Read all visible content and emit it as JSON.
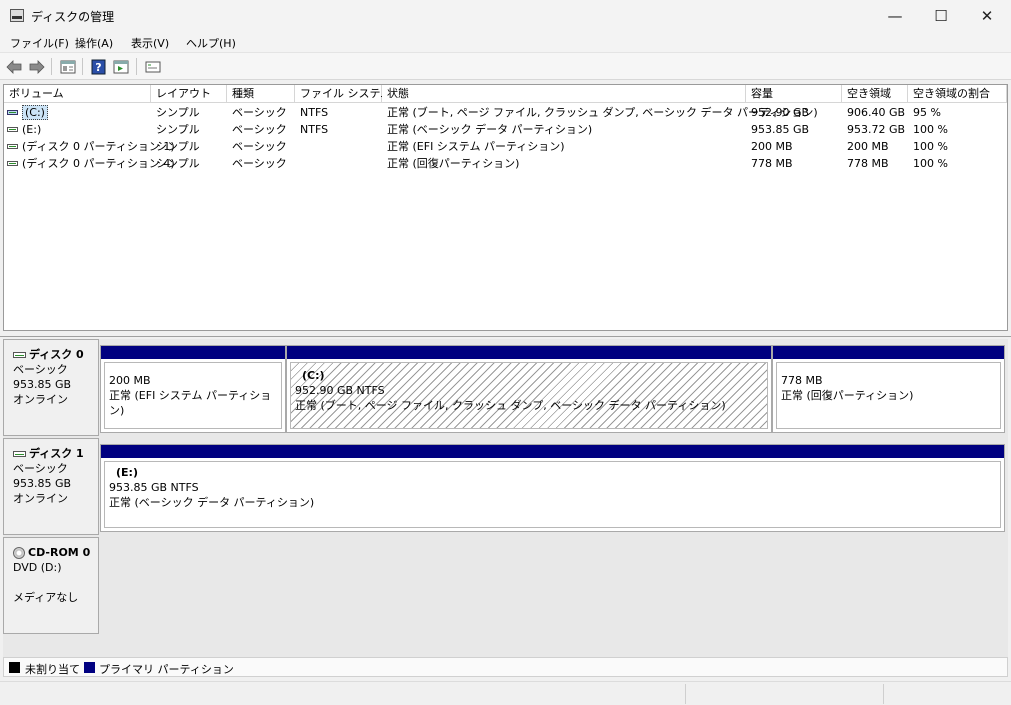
{
  "window": {
    "title": "ディスクの管理",
    "minimize": "—",
    "maximize": "☐",
    "close": "✕"
  },
  "menu": [
    "ファイル(F)",
    "操作(A)",
    "表示(V)",
    "ヘルプ(H)"
  ],
  "toolbar": {
    "icons": [
      "back-arrow-icon",
      "forward-arrow-icon",
      "properties-icon",
      "help-icon",
      "show-hide-pane-icon",
      "console-icon"
    ]
  },
  "volume_table": {
    "columns": [
      "ボリューム",
      "レイアウト",
      "種類",
      "ファイル システム",
      "状態",
      "容量",
      "空き領域",
      "空き領域の割合"
    ],
    "rows": [
      [
        "(C:)",
        "シンプル",
        "ベーシック",
        "NTFS",
        "正常 (ブート, ページ ファイル, クラッシュ ダンプ, ベーシック データ パーティション)",
        "952.90 GB",
        "906.40 GB",
        "95 %"
      ],
      [
        "(E:)",
        "シンプル",
        "ベーシック",
        "NTFS",
        "正常 (ベーシック データ パーティション)",
        "953.85 GB",
        "953.72 GB",
        "100 %"
      ],
      [
        "(ディスク 0 パーティション 1)",
        "シンプル",
        "ベーシック",
        "",
        "正常 (EFI システム パーティション)",
        "200 MB",
        "200 MB",
        "100 %"
      ],
      [
        "(ディスク 0 パーティション 4)",
        "シンプル",
        "ベーシック",
        "",
        "正常 (回復パーティション)",
        "778 MB",
        "778 MB",
        "100 %"
      ]
    ]
  },
  "disks": [
    {
      "name": "ディスク 0",
      "type": "ベーシック",
      "size": "953.85 GB",
      "status": "オンライン",
      "partitions": [
        {
          "name": "",
          "size": "200 MB",
          "status": "正常 (EFI システム パーティション)"
        },
        {
          "name": "(C:)",
          "size": "952.90 GB NTFS",
          "status": "正常 (ブート, ページ ファイル, クラッシュ ダンプ, ベーシック データ パーティション)"
        },
        {
          "name": "",
          "size": "778 MB",
          "status": "正常 (回復パーティション)"
        }
      ]
    },
    {
      "name": "ディスク 1",
      "type": "ベーシック",
      "size": "953.85 GB",
      "status": "オンライン",
      "partitions": [
        {
          "name": "(E:)",
          "size": "953.85 GB NTFS",
          "status": "正常 (ベーシック データ パーティション)"
        }
      ]
    },
    {
      "name": "CD-ROM 0",
      "type": "DVD (D:)",
      "status": "メディアなし"
    }
  ],
  "legend": {
    "unallocated": "未割り当て",
    "primary": "プライマリ パーティション",
    "colors": {
      "unallocated": "#000000",
      "primary": "#000080"
    }
  }
}
